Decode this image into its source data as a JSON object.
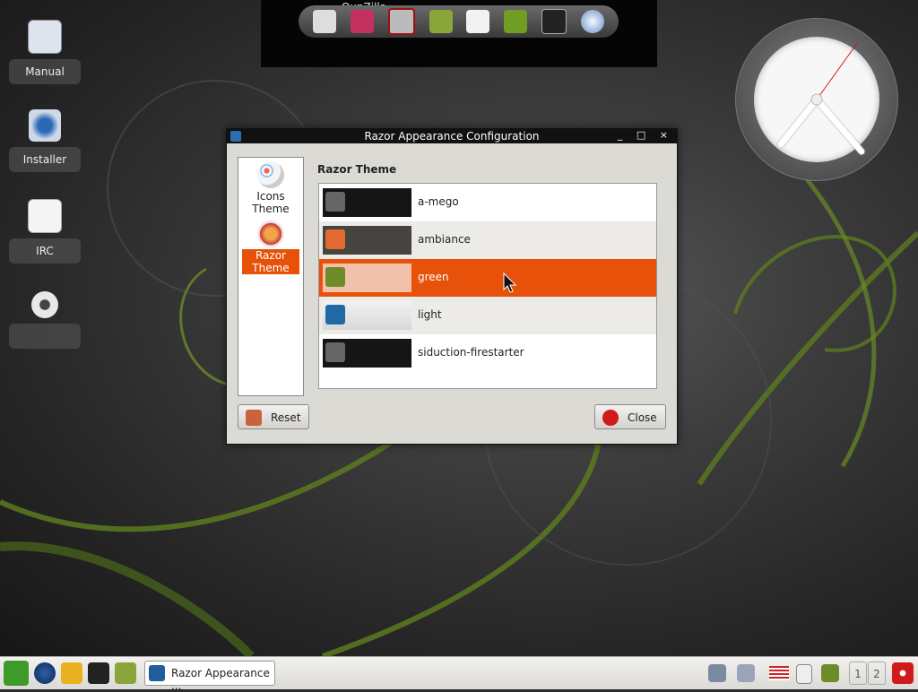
{
  "desktop_icons": [
    {
      "label": "Manual",
      "icon": "manual-icon"
    },
    {
      "label": "Installer",
      "icon": "installer-icon"
    },
    {
      "label": "IRC",
      "icon": "irc-icon"
    },
    {
      "label": "",
      "icon": "gear-icon"
    }
  ],
  "quicklaunch": {
    "title": "QupZilla",
    "items": [
      "file-manager-icon",
      "screenshot-icon",
      "editor-icon",
      "video-icon",
      "notepad-icon",
      "paint-icon",
      "terminal-icon",
      "globe-icon"
    ]
  },
  "dialog": {
    "title": "Razor Appearance Configuration",
    "window_buttons": "_ □ ×",
    "sidebar": [
      {
        "label": "Icons Theme",
        "selected": false
      },
      {
        "label": "Razor Theme",
        "selected": true
      }
    ],
    "header": "Razor Theme",
    "themes": [
      {
        "name": "a-mego",
        "thumb": "#151515",
        "icon": "#666666"
      },
      {
        "name": "ambiance",
        "thumb": "#45443e",
        "icon": "#e36a32"
      },
      {
        "name": "green",
        "thumb": "#f2c1aa",
        "icon": "#6e8b2a",
        "selected": true
      },
      {
        "name": "light",
        "thumb": "#e6e6e6",
        "icon": "#1f6aa5"
      },
      {
        "name": "siduction-firestarter",
        "thumb": "#151515",
        "icon": "#666666"
      }
    ],
    "reset_label": "Reset",
    "close_label": "Close"
  },
  "taskbar": {
    "task_label": "Razor Appearance ...",
    "pages": [
      "1",
      "2"
    ]
  },
  "colors": {
    "accent": "#e8510a",
    "titlebar": "#111111"
  }
}
